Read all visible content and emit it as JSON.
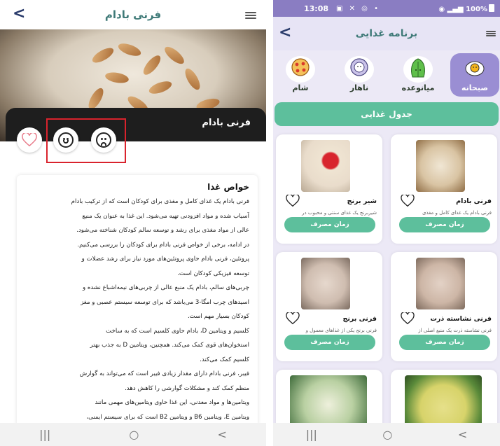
{
  "left": {
    "header": {
      "title": "فرنی بادام",
      "back_icon": "chevron-left-icon",
      "menu_icon": "menu-icon"
    },
    "hero": {
      "caption": "فرنی بادام"
    },
    "actions": {
      "favorite_icon": "heart-icon",
      "like_icon": "smiley-happy-icon",
      "dislike_icon": "smiley-sad-icon"
    },
    "info": {
      "title": "خواص غذا",
      "lines": [
        "فرنی بادام یک غذای کامل و مغذی برای کودکان است که از ترکیب بادام",
        "آسیاب شده و مواد افزودنی تهیه می‌شود. این غذا به عنوان یک منبع",
        "عالی از مواد مغذی برای رشد و توسعه سالم کودکان شناخته می‌شود.",
        "در ادامه، برخی از خواص فرنی بادام برای کودکان را بررسی می‌کنیم.",
        "پروتئین، فرنی بادام حاوی پروتئین‌های مورد نیاز برای رشد عضلات و",
        "توسعه فیزیکی کودکان است.",
        "چربی‌های سالم، بادام یک منبع عالی از چربی‌های نیمه‌اشباع نشده و",
        "اسیدهای چرب امگا-3 می‌باشد که برای توسعه سیستم عصبی و مغز",
        "کودکان بسیار مهم است.",
        "کلسیم و ویتامین D، بادام حاوی کلسیم است که به ساخت",
        "استخوان‌های قوی کمک می‌کند. همچنین، ویتامین D به جذب بهتر",
        "کلسیم کمک می‌کند.",
        "فیبر، فرنی بادام دارای مقدار زیادی فیبر است که می‌تواند به گوارش",
        "منظم کمک کند و مشکلات گوارشی را کاهش دهد.",
        "ویتامین‌ها و مواد معدنی، این غذا حاوی ویتامین‌های مهمی مانند",
        "ویتامین E، ویتامین B6 و ویتامین B2 است که برای سیستم ایمنی،"
      ]
    },
    "navbar": {
      "recent": "|||",
      "home": "○",
      "back": "<"
    }
  },
  "right": {
    "status": {
      "time": "13:08",
      "icons": "▣ ✕ ◎ •",
      "right": "100%"
    },
    "header": {
      "title": "برنامه غذایی",
      "back_icon": "chevron-left-icon",
      "menu_icon": "menu-icon"
    },
    "meals": [
      {
        "label": "صبحانه",
        "icon": "fried-egg-icon",
        "active": true
      },
      {
        "label": "میانوعده",
        "icon": "lettuce-icon",
        "active": false
      },
      {
        "label": "ناهار",
        "icon": "plate-icon",
        "active": false
      },
      {
        "label": "شام",
        "icon": "pizza-icon",
        "active": false
      }
    ],
    "table_button": "جدول غذایی",
    "foods": [
      {
        "name": "فرنی بادام",
        "desc": "فرنی بادام یک غذای کامل و مغذی",
        "button": "زمان مصرف",
        "color": "#d9c4a3"
      },
      {
        "name": "شیر برنج",
        "desc": "شیربرنج یک غذای سنتی و محبوب در",
        "button": "زمان مصرف",
        "color": "#e9dccb"
      },
      {
        "name": "فرنی نشاسته ذرت",
        "desc": "فرنی نشاسته ذرت یک منبع اصلی از",
        "button": "زمان مصرف",
        "color": "#cdb6a6"
      },
      {
        "name": "فرنی برنج",
        "desc": "فرنی برنج یکی از غذاهای معمول و",
        "button": "زمان مصرف",
        "color": "#cfbdb0"
      },
      {
        "name": "",
        "desc": "",
        "button": "",
        "color": "#d7d36a"
      },
      {
        "name": "",
        "desc": "",
        "button": "",
        "color": "#b9d0a2"
      }
    ],
    "navbar": {
      "recent": "|||",
      "home": "○",
      "back": "<"
    }
  }
}
